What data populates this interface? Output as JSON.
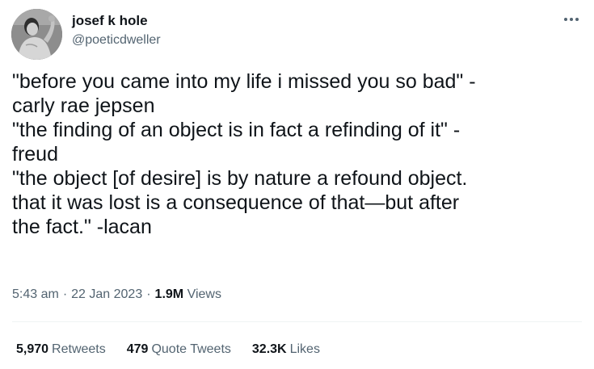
{
  "author": {
    "display_name": "josef k hole",
    "handle": "@poeticdweller"
  },
  "tweet": {
    "text": "\"before you came into my life i missed you so bad\" -\ncarly rae jepsen\n\"the finding of an object is in fact a refinding of it\" -\nfreud\n\"the object [of desire] is by nature a refound object.\nthat it was lost is a consequence of that—but after\nthe fact.\" -lacan"
  },
  "meta": {
    "time": "5:43 am",
    "separator": "·",
    "date": "22 Jan 2023",
    "views_count": "1.9M",
    "views_label": "Views"
  },
  "stats": {
    "retweets": {
      "count": "5,970",
      "label": "Retweets"
    },
    "quotes": {
      "count": "479",
      "label": "Quote Tweets"
    },
    "likes": {
      "count": "32.3K",
      "label": "Likes"
    }
  },
  "icons": {
    "more": "more-horizontal-icon",
    "avatar": "profile-photo"
  },
  "colors": {
    "text_primary": "#0f1419",
    "text_secondary": "#536471",
    "divider": "#eff3f4"
  }
}
